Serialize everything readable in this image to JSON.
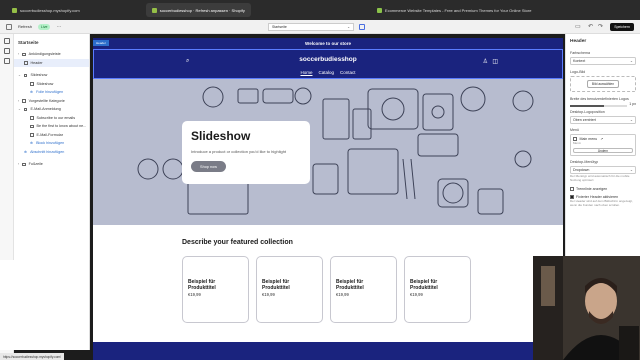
{
  "browser": {
    "tabs": [
      {
        "title": "soccerbudiesshop.myshopify.com",
        "active": false
      },
      {
        "title": "soccerbudiesshop · Refresh anpassen · Shopify",
        "active": true
      },
      {
        "title": "Ecommerce Website Templates - Free and Premium Themes for Your Online Store",
        "active": false
      }
    ]
  },
  "editor_bar": {
    "theme_name": "Refresh",
    "live_label": "Live",
    "page_select": "Startseite",
    "save_label": "Speichern"
  },
  "sidebar": {
    "title": "Startseite",
    "items": [
      {
        "label": "Ankündigungsleiste",
        "level": 0
      },
      {
        "label": "Header",
        "level": 1,
        "active": true
      },
      {
        "label": "Slideshow",
        "level": 0
      },
      {
        "label": "Slideshow",
        "level": 1
      },
      {
        "label": "Folie hinzufügen",
        "level": 1,
        "link": true
      },
      {
        "label": "Vorgestellte Kategorie",
        "level": 0
      },
      {
        "label": "E-Mail-Anmeldung",
        "level": 0
      },
      {
        "label": "Subscribe to our emails",
        "level": 1
      },
      {
        "label": "Be the first to know about ne...",
        "level": 1
      },
      {
        "label": "E-Mail-Formular",
        "level": 1
      },
      {
        "label": "Block hinzufügen",
        "level": 1,
        "link": true
      },
      {
        "label": "Abschnitt hinzufügen",
        "level": 0,
        "link": true
      },
      {
        "label": "Fußzeile",
        "level": 0
      }
    ]
  },
  "preview": {
    "section_label": "Header",
    "announcement": "Welcome to our store",
    "store_name": "soccerbudiesshop",
    "nav": [
      "Home",
      "Catalog",
      "Contact"
    ],
    "hero": {
      "title": "Slideshow",
      "text": "Introduce a product or collection you'd like to highlight",
      "button": "Shop now"
    },
    "featured": {
      "title": "Describe your featured collection",
      "products": [
        {
          "title": "Beispiel für Produkttitel",
          "price": "€19,99"
        },
        {
          "title": "Beispiel für Produkttitel",
          "price": "€19,99"
        },
        {
          "title": "Beispiel für Produkttitel",
          "price": "€19,99"
        },
        {
          "title": "Beispiel für Produkttitel",
          "price": "€19,99"
        }
      ]
    }
  },
  "right_panel": {
    "title": "Header",
    "color_scheme_label": "Farbschema",
    "color_scheme_value": "Kontext",
    "logo_label": "Logo-Bild",
    "logo_button": "Bild auswählen",
    "logo_width_label": "Breite des benutzerdefinierten Logos",
    "logo_width_value": "1 px",
    "logo_width_fraction": 0.6,
    "desktop_logo_label": "Desktop-Logoposition",
    "desktop_logo_value": "Oben zentriert",
    "menu_label": "Menü",
    "menu_value": "Main menu",
    "menu_sub": "Menü",
    "menu_change": "Ändern",
    "desktop_menu_label": "Desktop-Menütyp",
    "desktop_menu_value": "Dropdown",
    "desktop_menu_note": "Der Menütyp wird automatisch für die mobile Nutzung optimiert",
    "divider_label": "Trennlinie anzeigen",
    "divider_checked": false,
    "sticky_label": "Fixierter Header aktivieren",
    "sticky_checked": true,
    "sticky_note": "Der Header wird auf dem Bildschirm angezeigt, wenn die Kunden nach oben scrollen."
  },
  "status_url": "https://soccerbudiesshop.myshopify.com/"
}
